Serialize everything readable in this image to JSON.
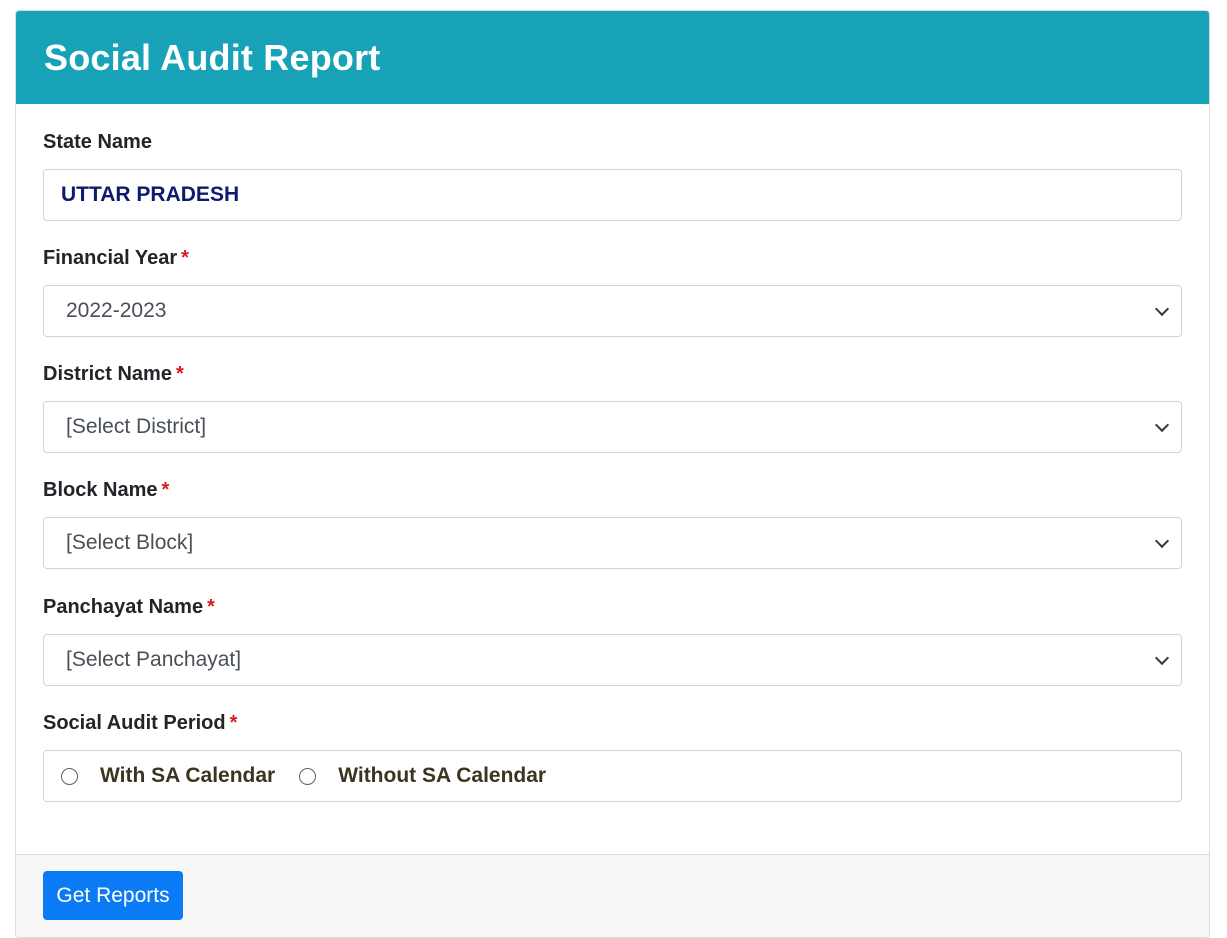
{
  "header": {
    "title": "Social Audit Report"
  },
  "form": {
    "state": {
      "label": "State Name",
      "value": "UTTAR PRADESH"
    },
    "financial_year": {
      "label": "Financial Year",
      "required_mark": "*",
      "value": "2022-2023"
    },
    "district": {
      "label": "District Name",
      "required_mark": "*",
      "value": "[Select District]"
    },
    "block": {
      "label": "Block Name",
      "required_mark": "*",
      "value": "[Select Block]"
    },
    "panchayat": {
      "label": "Panchayat Name",
      "required_mark": "*",
      "value": "[Select Panchayat]"
    },
    "audit_period": {
      "label": "Social Audit Period",
      "required_mark": "*",
      "options": [
        "With SA Calendar",
        "Without SA Calendar"
      ]
    }
  },
  "footer": {
    "submit_label": "Get Reports"
  },
  "icons": {
    "select_arrow": "chevron-down-icon",
    "radio": "radio-unchecked-icon"
  },
  "colors": {
    "header_bg": "#17a2b8",
    "button_bg": "#0b7bf5",
    "required": "#d41e1e"
  }
}
